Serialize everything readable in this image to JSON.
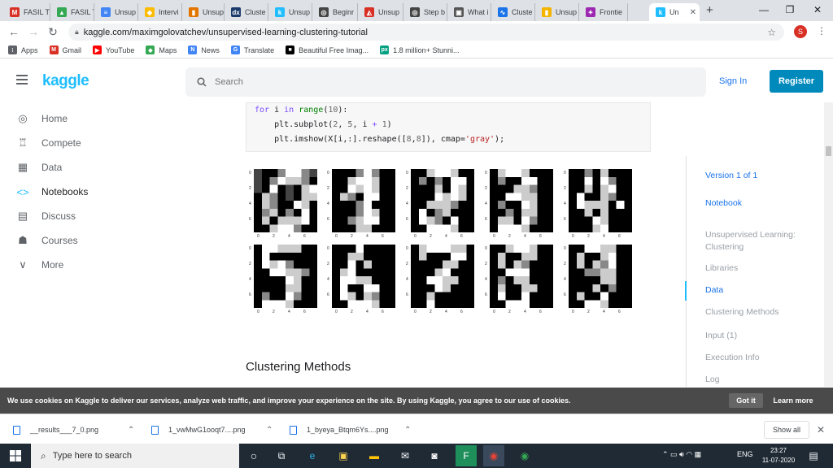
{
  "browser": {
    "tabs": [
      {
        "label": "FASIL T",
        "color": "#d93025",
        "glyph": "M"
      },
      {
        "label": "FASIL T",
        "color": "#34a853",
        "glyph": "▲"
      },
      {
        "label": "Unsup",
        "color": "#4285f4",
        "glyph": "≡"
      },
      {
        "label": "Intervi",
        "color": "#fbbc04",
        "glyph": "◆"
      },
      {
        "label": "Unsup",
        "color": "#e37400",
        "glyph": "▮"
      },
      {
        "label": "Cluste",
        "color": "#1a3a6b",
        "glyph": "dx"
      },
      {
        "label": "Unsup",
        "color": "#20beff",
        "glyph": "k"
      },
      {
        "label": "Beginr",
        "color": "#444",
        "glyph": "◎"
      },
      {
        "label": "Unsup",
        "color": "#d93025",
        "glyph": "◭"
      },
      {
        "label": "Step b",
        "color": "#444",
        "glyph": "◎"
      },
      {
        "label": "What i",
        "color": "#555",
        "glyph": "▣"
      },
      {
        "label": "Cluste",
        "color": "#1a73e8",
        "glyph": "∿"
      },
      {
        "label": "Unsup",
        "color": "#f4b400",
        "glyph": "▮"
      },
      {
        "label": "Frontie",
        "color": "#9c27b0",
        "glyph": "✦"
      },
      {
        "label": "Un",
        "color": "#20beff",
        "glyph": "k"
      }
    ],
    "new_tab": "+",
    "url": "kaggle.com/maximgolovatchev/unsupervised-learning-clustering-tutorial",
    "profile_initial": "S",
    "bookmarks": [
      {
        "label": "Apps",
        "color": "#5f6368",
        "glyph": "⁝"
      },
      {
        "label": "Gmail",
        "color": "#d93025",
        "glyph": "M"
      },
      {
        "label": "YouTube",
        "color": "#ff0000",
        "glyph": "▶"
      },
      {
        "label": "Maps",
        "color": "#34a853",
        "glyph": "◆"
      },
      {
        "label": "News",
        "color": "#4285f4",
        "glyph": "N"
      },
      {
        "label": "Translate",
        "color": "#4285f4",
        "glyph": "G"
      },
      {
        "label": "Beautiful Free Imag...",
        "color": "#000",
        "glyph": "■"
      },
      {
        "label": "1.8 million+ Stunni...",
        "color": "#05a081",
        "glyph": "px"
      }
    ]
  },
  "kaggle": {
    "logo": "kaggle",
    "search_placeholder": "Search",
    "sign_in": "Sign In",
    "register": "Register",
    "nav": [
      {
        "label": "Home",
        "icon": "◎"
      },
      {
        "label": "Compete",
        "icon": "♖"
      },
      {
        "label": "Data",
        "icon": "▦"
      },
      {
        "label": "Notebooks",
        "icon": "<>"
      },
      {
        "label": "Discuss",
        "icon": "▤"
      },
      {
        "label": "Courses",
        "icon": "☗"
      },
      {
        "label": "More",
        "icon": "∨"
      }
    ],
    "code_lines": [
      "for i in range(10):",
      "    plt.subplot(2, 5, i + 1)",
      "    plt.imshow(X[i,:].reshape([8,8]), cmap='gray');"
    ],
    "x_ticks": [
      "0",
      "2",
      "4",
      "6"
    ],
    "y_ticks": [
      "0",
      "2",
      "4",
      "6"
    ],
    "section_title": "Clustering Methods",
    "toc": [
      {
        "label": "Version 1 of 1",
        "style": "blue"
      },
      {
        "label": "Notebook",
        "style": "blue"
      },
      {
        "label": "Unsupervised Learning: Clustering",
        "style": "gray"
      },
      {
        "label": "Libraries",
        "style": "gray"
      },
      {
        "label": "Data",
        "style": "blue"
      },
      {
        "label": "Clustering Methods",
        "style": "gray"
      },
      {
        "label": "Input (1)",
        "style": "gray"
      },
      {
        "label": "Execution Info",
        "style": "gray"
      },
      {
        "label": "Log",
        "style": "gray"
      }
    ],
    "cookie_text": "We use cookies on Kaggle to deliver our services, analyze web traffic, and improve your experience on the site. By using Kaggle, you agree to our use of cookies.",
    "got_it": "Got it",
    "learn_more": "Learn more"
  },
  "downloads": {
    "items": [
      "__results___7_0.png",
      "1_vwMwG1ooqt7....png",
      "1_byeya_Btqm6Ys....png"
    ],
    "show_all": "Show all"
  },
  "taskbar": {
    "search_placeholder": "Type here to search",
    "lang": "ENG",
    "time": "23:27",
    "date": "11-07-2020",
    "notifications": "1"
  }
}
